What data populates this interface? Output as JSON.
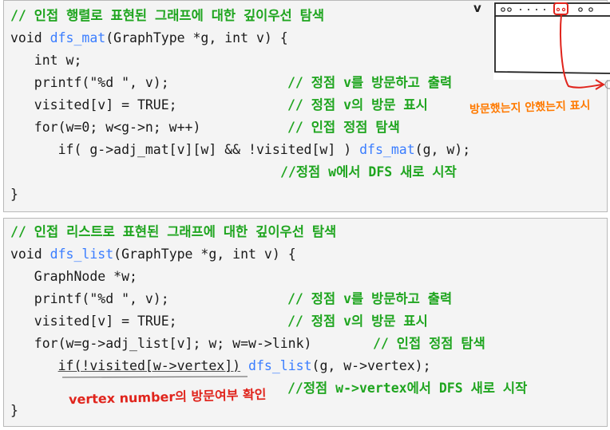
{
  "block1": {
    "header_comment": "// 인접 행렬로 표현된 그래프에 대한 깊이우선 탐색",
    "sig_pre": "void ",
    "sig_fn": "dfs_mat",
    "sig_post": "(GraphType *g, int v) {",
    "l2": "   int w;",
    "l3_code": "   printf(\"%d \", v);",
    "l3_comment": "// 정점 v를 방문하고 출력",
    "l4_code": "   visited[v] = TRUE;",
    "l4_comment": "// 정점 v의 방문 표시",
    "l5_code": "   for(w=0; w<g->n; w++)",
    "l5_comment": "// 인접 정점 탐색",
    "l6_pre": "      if( g->adj_mat[v][w] && !visited[w] ) ",
    "l6_fn": "dfs_mat",
    "l6_post": "(g, w);",
    "l7_comment": "//정점 w에서 DFS 새로 시작",
    "close": "}"
  },
  "block2": {
    "header_comment": "// 인접 리스트로 표현된 그래프에 대한 깊이우선 탐색",
    "sig_pre": "void ",
    "sig_fn": "dfs_list",
    "sig_post": "(GraphType *g, int v) {",
    "l2": "   GraphNode *w;",
    "l3_code": "   printf(\"%d \", v);",
    "l3_comment": "// 정점 v를 방문하고 출력",
    "l4_code": "   visited[v] = TRUE;",
    "l4_comment": "// 정점 v의 방문 표시",
    "l5_code": "   for(w=g->adj_list[v]; w; w=w->link)",
    "l5_comment": "// 인접 정점 탐색",
    "l6_indent": "      ",
    "l6_ul": "if(!visited[w->vertex])",
    "l6_sp": " ",
    "l6_fn": "dfs_list",
    "l6_post": "(g, w->vertex);",
    "l7_comment": "//정점 w->vertex에서 DFS 새로 시작",
    "close": "}"
  },
  "annotations": {
    "orange_note": "방문했는지 안했는지 표시",
    "red_note": "vertex number의 방문여부 확인",
    "sketch_label": "v",
    "colors": {
      "orange": "#ff7a00",
      "red": "#e0241c",
      "comment": "#1fa51f",
      "function": "#3a7dff"
    }
  }
}
